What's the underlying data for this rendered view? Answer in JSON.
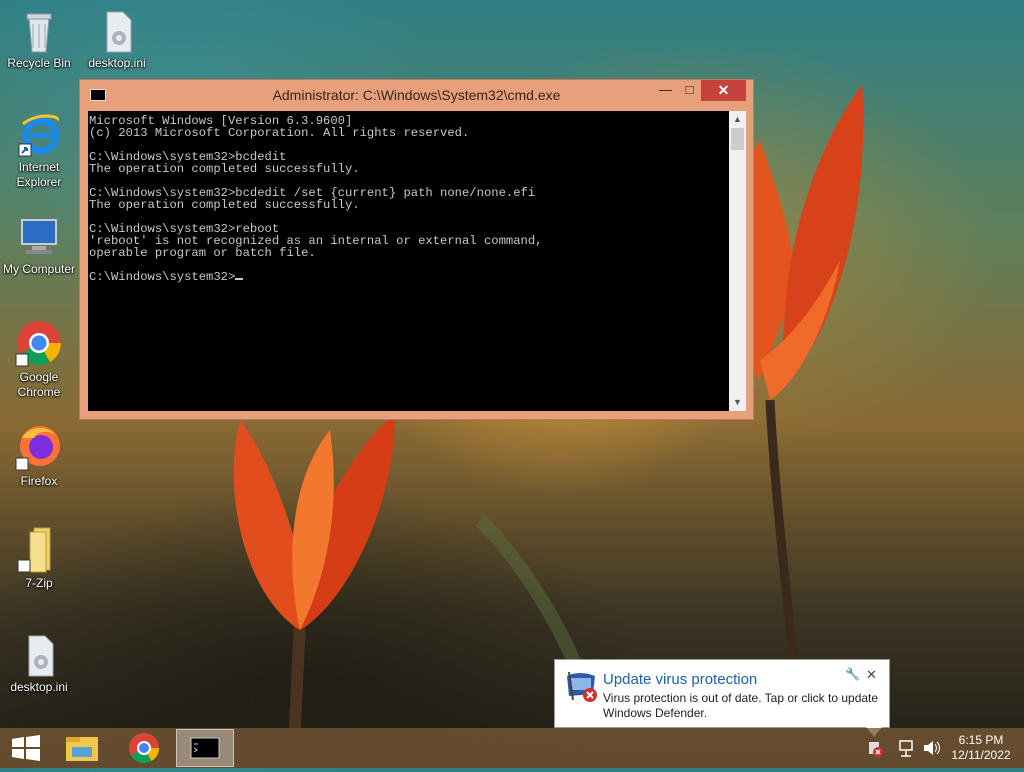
{
  "desktop": {
    "icons": [
      {
        "label": "Recycle Bin",
        "icon": "recycle-bin-icon"
      },
      {
        "label": "desktop.ini",
        "icon": "settings-file-icon"
      },
      {
        "label": "Internet\nExplorer",
        "line1": "Internet",
        "line2": "Explorer",
        "icon": "internet-explorer-icon"
      },
      {
        "label": "My Computer",
        "icon": "computer-icon"
      },
      {
        "line1": "Google",
        "line2": "Chrome",
        "icon": "chrome-icon"
      },
      {
        "label": "Firefox",
        "icon": "firefox-icon"
      },
      {
        "label": "7-Zip",
        "icon": "folder-icon"
      },
      {
        "label": "desktop.ini",
        "icon": "settings-file-icon"
      }
    ]
  },
  "cmd_window": {
    "title": "Administrator: C:\\Windows\\System32\\cmd.exe",
    "minimize": "—",
    "maximize": "□",
    "close": "✕",
    "console_text": "Microsoft Windows [Version 6.3.9600]\n(c) 2013 Microsoft Corporation. All rights reserved.\n\nC:\\Windows\\system32>bcdedit\nThe operation completed successfully.\n\nC:\\Windows\\system32>bcdedit /set {current} path none/none.efi\nThe operation completed successfully.\n\nC:\\Windows\\system32>reboot\n'reboot' is not recognized as an internal or external command,\noperable program or batch file.\n\nC:\\Windows\\system32>"
  },
  "notification": {
    "title": "Update virus protection",
    "message": "Virus protection is out of date. Tap or click to update Windows Defender.",
    "close": "✕",
    "icon": "defender-error-icon"
  },
  "taskbar": {
    "clock_time": "6:15 PM",
    "clock_date": "12/11/2022",
    "colors": {
      "accent_close": "#c7423a",
      "window_frame": "#e8a07c",
      "toast_title": "#1c5fae"
    }
  }
}
